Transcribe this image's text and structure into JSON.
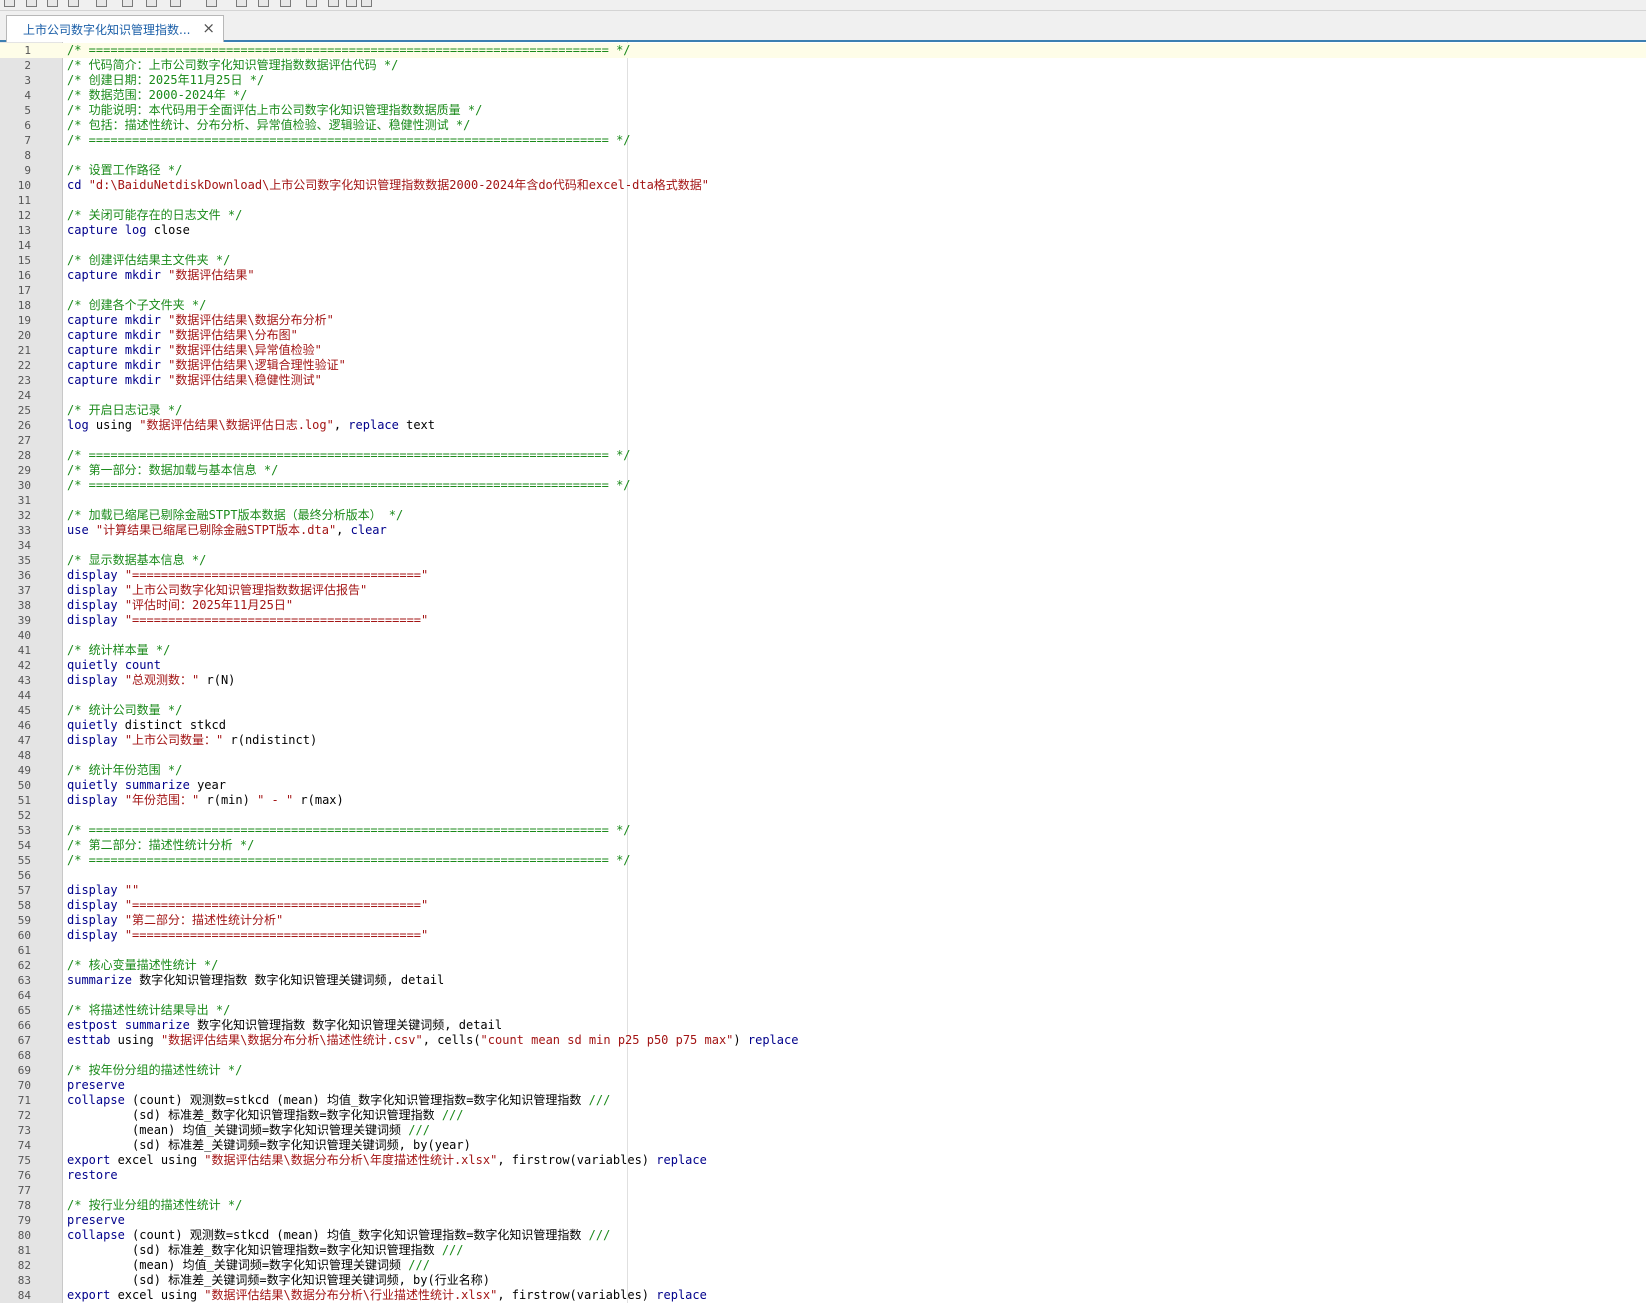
{
  "toolbar": {
    "icons": [
      "new-file-icon",
      "open-folder-icon",
      "save-icon",
      "save-all-icon",
      "print-icon",
      "find-icon",
      "cut-icon",
      "copy-icon",
      "paste-icon",
      "undo-icon",
      "redo-icon",
      "indent-icon",
      "outdent-icon",
      "bookmark-icon",
      "window-icon",
      "dropdown-icon"
    ]
  },
  "tab": {
    "title": "上市公司数字化知识管理指数...",
    "close": "×"
  },
  "colors": {
    "comment": "#1a8a1a",
    "keyword": "#00008b",
    "string": "#a31515",
    "plain": "#000000",
    "gutter": "#e4e4e4",
    "accent": "#3c7fb1"
  },
  "editor": {
    "current_line": 1,
    "lines": [
      [
        [
          "c",
          "/* ======================================================================== */"
        ]
      ],
      [
        [
          "c",
          "/* 代码简介：上市公司数字化知识管理指数数据评估代码 */"
        ]
      ],
      [
        [
          "c",
          "/* 创建日期：2025年11月25日 */"
        ]
      ],
      [
        [
          "c",
          "/* 数据范围：2000-2024年 */"
        ]
      ],
      [
        [
          "c",
          "/* 功能说明：本代码用于全面评估上市公司数字化知识管理指数数据质量 */"
        ]
      ],
      [
        [
          "c",
          "/* 包括：描述性统计、分布分析、异常值检验、逻辑验证、稳健性测试 */"
        ]
      ],
      [
        [
          "c",
          "/* ======================================================================== */"
        ]
      ],
      [],
      [
        [
          "c",
          "/* 设置工作路径 */"
        ]
      ],
      [
        [
          "k",
          "cd"
        ],
        [
          "p",
          " "
        ],
        [
          "s",
          "\"d:\\BaiduNetdiskDownload\\上市公司数字化知识管理指数数据2000-2024年含do代码和excel-dta格式数据\""
        ]
      ],
      [],
      [
        [
          "c",
          "/* 关闭可能存在的日志文件 */"
        ]
      ],
      [
        [
          "k",
          "capture"
        ],
        [
          "p",
          " "
        ],
        [
          "k",
          "log"
        ],
        [
          "p",
          " close"
        ]
      ],
      [],
      [
        [
          "c",
          "/* 创建评估结果主文件夹 */"
        ]
      ],
      [
        [
          "k",
          "capture"
        ],
        [
          "p",
          " "
        ],
        [
          "k",
          "mkdir"
        ],
        [
          "p",
          " "
        ],
        [
          "s",
          "\"数据评估结果\""
        ]
      ],
      [],
      [
        [
          "c",
          "/* 创建各个子文件夹 */"
        ]
      ],
      [
        [
          "k",
          "capture"
        ],
        [
          "p",
          " "
        ],
        [
          "k",
          "mkdir"
        ],
        [
          "p",
          " "
        ],
        [
          "s",
          "\"数据评估结果\\数据分布分析\""
        ]
      ],
      [
        [
          "k",
          "capture"
        ],
        [
          "p",
          " "
        ],
        [
          "k",
          "mkdir"
        ],
        [
          "p",
          " "
        ],
        [
          "s",
          "\"数据评估结果\\分布图\""
        ]
      ],
      [
        [
          "k",
          "capture"
        ],
        [
          "p",
          " "
        ],
        [
          "k",
          "mkdir"
        ],
        [
          "p",
          " "
        ],
        [
          "s",
          "\"数据评估结果\\异常值检验\""
        ]
      ],
      [
        [
          "k",
          "capture"
        ],
        [
          "p",
          " "
        ],
        [
          "k",
          "mkdir"
        ],
        [
          "p",
          " "
        ],
        [
          "s",
          "\"数据评估结果\\逻辑合理性验证\""
        ]
      ],
      [
        [
          "k",
          "capture"
        ],
        [
          "p",
          " "
        ],
        [
          "k",
          "mkdir"
        ],
        [
          "p",
          " "
        ],
        [
          "s",
          "\"数据评估结果\\稳健性测试\""
        ]
      ],
      [],
      [
        [
          "c",
          "/* 开启日志记录 */"
        ]
      ],
      [
        [
          "k",
          "log"
        ],
        [
          "p",
          " using "
        ],
        [
          "s",
          "\"数据评估结果\\数据评估日志.log\""
        ],
        [
          "p",
          ", "
        ],
        [
          "k",
          "replace"
        ],
        [
          "p",
          " text"
        ]
      ],
      [],
      [
        [
          "c",
          "/* ======================================================================== */"
        ]
      ],
      [
        [
          "c",
          "/* 第一部分：数据加载与基本信息 */"
        ]
      ],
      [
        [
          "c",
          "/* ======================================================================== */"
        ]
      ],
      [],
      [
        [
          "c",
          "/* 加载已缩尾已剔除金融STPT版本数据（最终分析版本） */"
        ]
      ],
      [
        [
          "k",
          "use"
        ],
        [
          "p",
          " "
        ],
        [
          "s",
          "\"计算结果已缩尾已剔除金融STPT版本.dta\""
        ],
        [
          "p",
          ", "
        ],
        [
          "k",
          "clear"
        ]
      ],
      [],
      [
        [
          "c",
          "/* 显示数据基本信息 */"
        ]
      ],
      [
        [
          "k",
          "display"
        ],
        [
          "p",
          " "
        ],
        [
          "s",
          "\"========================================\""
        ]
      ],
      [
        [
          "k",
          "display"
        ],
        [
          "p",
          " "
        ],
        [
          "s",
          "\"上市公司数字化知识管理指数数据评估报告\""
        ]
      ],
      [
        [
          "k",
          "display"
        ],
        [
          "p",
          " "
        ],
        [
          "s",
          "\"评估时间：2025年11月25日\""
        ]
      ],
      [
        [
          "k",
          "display"
        ],
        [
          "p",
          " "
        ],
        [
          "s",
          "\"========================================\""
        ]
      ],
      [],
      [
        [
          "c",
          "/* 统计样本量 */"
        ]
      ],
      [
        [
          "k",
          "quietly"
        ],
        [
          "p",
          " "
        ],
        [
          "k",
          "count"
        ]
      ],
      [
        [
          "k",
          "display"
        ],
        [
          "p",
          " "
        ],
        [
          "s",
          "\"总观测数：\""
        ],
        [
          "p",
          " r(N)"
        ]
      ],
      [],
      [
        [
          "c",
          "/* 统计公司数量 */"
        ]
      ],
      [
        [
          "k",
          "quietly"
        ],
        [
          "p",
          " distinct stkcd"
        ]
      ],
      [
        [
          "k",
          "display"
        ],
        [
          "p",
          " "
        ],
        [
          "s",
          "\"上市公司数量：\""
        ],
        [
          "p",
          " r(ndistinct)"
        ]
      ],
      [],
      [
        [
          "c",
          "/* 统计年份范围 */"
        ]
      ],
      [
        [
          "k",
          "quietly"
        ],
        [
          "p",
          " "
        ],
        [
          "k",
          "summarize"
        ],
        [
          "p",
          " year"
        ]
      ],
      [
        [
          "k",
          "display"
        ],
        [
          "p",
          " "
        ],
        [
          "s",
          "\"年份范围：\""
        ],
        [
          "p",
          " r(min) "
        ],
        [
          "s",
          "\" - \""
        ],
        [
          "p",
          " r(max)"
        ]
      ],
      [],
      [
        [
          "c",
          "/* ======================================================================== */"
        ]
      ],
      [
        [
          "c",
          "/* 第二部分：描述性统计分析 */"
        ]
      ],
      [
        [
          "c",
          "/* ======================================================================== */"
        ]
      ],
      [],
      [
        [
          "k",
          "display"
        ],
        [
          "p",
          " "
        ],
        [
          "s",
          "\"\""
        ]
      ],
      [
        [
          "k",
          "display"
        ],
        [
          "p",
          " "
        ],
        [
          "s",
          "\"========================================\""
        ]
      ],
      [
        [
          "k",
          "display"
        ],
        [
          "p",
          " "
        ],
        [
          "s",
          "\"第二部分：描述性统计分析\""
        ]
      ],
      [
        [
          "k",
          "display"
        ],
        [
          "p",
          " "
        ],
        [
          "s",
          "\"========================================\""
        ]
      ],
      [],
      [
        [
          "c",
          "/* 核心变量描述性统计 */"
        ]
      ],
      [
        [
          "k",
          "summarize"
        ],
        [
          "p",
          " 数字化知识管理指数 数字化知识管理关键词频, detail"
        ]
      ],
      [],
      [
        [
          "c",
          "/* 将描述性统计结果导出 */"
        ]
      ],
      [
        [
          "k",
          "estpost"
        ],
        [
          "p",
          " "
        ],
        [
          "k",
          "summarize"
        ],
        [
          "p",
          " 数字化知识管理指数 数字化知识管理关键词频, detail"
        ]
      ],
      [
        [
          "k",
          "esttab"
        ],
        [
          "p",
          " using "
        ],
        [
          "s",
          "\"数据评估结果\\数据分布分析\\描述性统计.csv\""
        ],
        [
          "p",
          ", cells("
        ],
        [
          "s",
          "\"count mean sd min p25 p50 p75 max\""
        ],
        [
          "p",
          ") "
        ],
        [
          "k",
          "replace"
        ]
      ],
      [],
      [
        [
          "c",
          "/* 按年份分组的描述性统计 */"
        ]
      ],
      [
        [
          "k",
          "preserve"
        ]
      ],
      [
        [
          "k",
          "collapse"
        ],
        [
          "p",
          " (count) 观测数=stkcd (mean) 均值_数字化知识管理指数=数字化知识管理指数 "
        ],
        [
          "c",
          "///"
        ]
      ],
      [
        [
          "p",
          "         (sd) 标准差_数字化知识管理指数=数字化知识管理指数 "
        ],
        [
          "c",
          "///"
        ]
      ],
      [
        [
          "p",
          "         (mean) 均值_关键词频=数字化知识管理关键词频 "
        ],
        [
          "c",
          "///"
        ]
      ],
      [
        [
          "p",
          "         (sd) 标准差_关键词频=数字化知识管理关键词频, by(year)"
        ]
      ],
      [
        [
          "k",
          "export"
        ],
        [
          "p",
          " excel using "
        ],
        [
          "s",
          "\"数据评估结果\\数据分布分析\\年度描述性统计.xlsx\""
        ],
        [
          "p",
          ", firstrow(variables) "
        ],
        [
          "k",
          "replace"
        ]
      ],
      [
        [
          "k",
          "restore"
        ]
      ],
      [],
      [
        [
          "c",
          "/* 按行业分组的描述性统计 */"
        ]
      ],
      [
        [
          "k",
          "preserve"
        ]
      ],
      [
        [
          "k",
          "collapse"
        ],
        [
          "p",
          " (count) 观测数=stkcd (mean) 均值_数字化知识管理指数=数字化知识管理指数 "
        ],
        [
          "c",
          "///"
        ]
      ],
      [
        [
          "p",
          "         (sd) 标准差_数字化知识管理指数=数字化知识管理指数 "
        ],
        [
          "c",
          "///"
        ]
      ],
      [
        [
          "p",
          "         (mean) 均值_关键词频=数字化知识管理关键词频 "
        ],
        [
          "c",
          "///"
        ]
      ],
      [
        [
          "p",
          "         (sd) 标准差_关键词频=数字化知识管理关键词频, by(行业名称)"
        ]
      ],
      [
        [
          "k",
          "export"
        ],
        [
          "p",
          " excel using "
        ],
        [
          "s",
          "\"数据评估结果\\数据分布分析\\行业描述性统计.xlsx\""
        ],
        [
          "p",
          ", firstrow(variables) "
        ],
        [
          "k",
          "replace"
        ]
      ]
    ]
  }
}
